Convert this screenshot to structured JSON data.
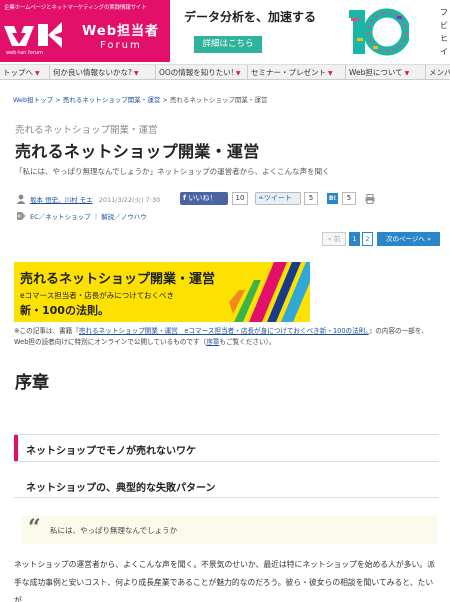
{
  "header": {
    "tagline": "企業ホームページとネットマーケティングの実践情報サイト",
    "brand_name": "Web担当者",
    "brand_sub": "Forum",
    "brand_small": "web-tan forum",
    "brand_color": "#e2106a"
  },
  "ad": {
    "title": "データ分析を、加速する",
    "button": "詳細はこちら",
    "graphic_text": "10",
    "side_lines": [
      "フ",
      "ビ",
      "ヒ",
      "イ"
    ]
  },
  "nav": {
    "items": [
      {
        "label": "トップへ"
      },
      {
        "label": "何か良い情報ないかな?"
      },
      {
        "label": "OOの情報を知りたい!"
      },
      {
        "label": "セミナー・プレゼント"
      },
      {
        "label": "Web担について"
      },
      {
        "label": "メンバ"
      }
    ]
  },
  "breadcrumb": {
    "items": [
      "Web担トップ",
      "売れるネットショップ開業・運営",
      "売れるネットショップ開業・運営"
    ],
    "separator": ">"
  },
  "article": {
    "category": "売れるネットショップ開業・運営",
    "title": "売れるネットショップ開業・運営",
    "lede": "「私には、やっぱり無理なんでしょうか」ネットショップの運営者から、よくこんな声を聞く",
    "authors": "坂本 悟史、川村 モエ",
    "date": "2011/3/22(火) 7:30",
    "like_label": "いいね！",
    "like_count": "10",
    "tweet_label": "ツイート",
    "tweet_count": "5",
    "hatena_label": "B!",
    "hatena_count": "5",
    "tags": "EC／ネットショップ ｜ 解説／ノウハウ"
  },
  "pager": {
    "prev": "« 前",
    "pages": [
      "1",
      "2"
    ],
    "next": "次のページへ »"
  },
  "book": {
    "title": "売れるネットショップ開業・運営",
    "sub1": "eコマース担当者・店長がみにつけておくべき",
    "sub2": "新・100の法則。"
  },
  "note": {
    "prefix": "※この記事は、書籍『",
    "link": "売れるネットショップ開業・運営　eコマース担当者・店長が身につけておくべき新・100の法則。",
    "suffix": "』の内容の一部を、Web担の読者向けに特別にオンラインで公開しているものです（",
    "link2": "序章",
    "suffix2": "もご覧ください）。"
  },
  "content": {
    "section_heading": "序章",
    "subhead_1": "ネットショップでモノが売れないワケ",
    "subhead_2": "ネットショップの、典型的な失敗パターン",
    "quote_mark": "“",
    "quote": "私には、やっぱり無理なんでしょうか",
    "body": "ネットショップの運営者から、よくこんな声を聞く。不景気のせいか、最近は特にネットショップを始める人が多い。派手な成功事例と安いコスト、何より成長産業であることが魅力的なのだろう。彼ら・彼女らの相談を聞いてみると、たいが"
  }
}
